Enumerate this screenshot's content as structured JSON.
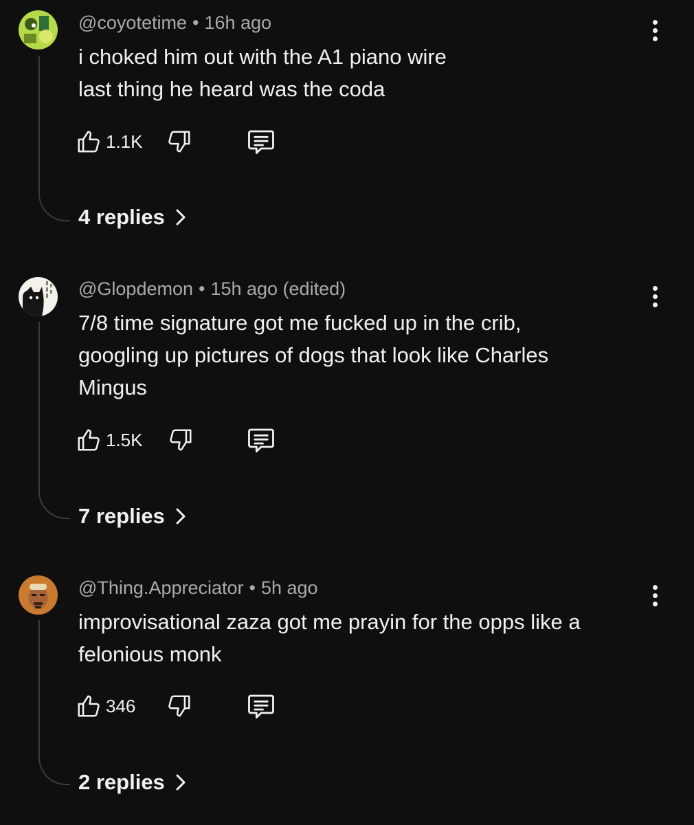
{
  "comments": [
    {
      "author": "@coyotetime",
      "separator": "•",
      "time": "16h ago",
      "lines": [
        "i choked him out with the A1 piano wire",
        "last thing he heard was the coda"
      ],
      "likes": "1.1K",
      "replies_label": "4 replies"
    },
    {
      "author": "@Glopdemon",
      "separator": "•",
      "time": "15h ago (edited)",
      "lines": [
        "7/8 time signature got me fucked up in the crib,",
        "googling up pictures of dogs that look like Charles",
        "Mingus"
      ],
      "likes": "1.5K",
      "replies_label": "7 replies"
    },
    {
      "author": "@Thing.Appreciator",
      "separator": "•",
      "time": "5h ago",
      "lines": [
        "improvisational zaza got me prayin for the opps like a",
        "felonious monk"
      ],
      "likes": "346",
      "replies_label": "2 replies"
    }
  ],
  "icons": {
    "like": "thumbs-up-icon",
    "dislike": "thumbs-down-icon",
    "reply": "comment-icon",
    "menu": "more-vertical-icon",
    "expand": "chevron-right-icon"
  },
  "colors": {
    "background": "#0f0f0f",
    "text": "#f1f1f1",
    "meta": "#aaaaaa",
    "thread": "#3a3a3a"
  }
}
